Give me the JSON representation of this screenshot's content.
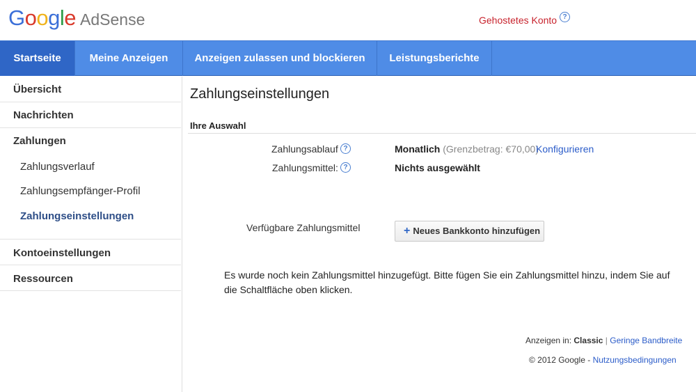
{
  "header": {
    "logo_google": [
      "G",
      "o",
      "o",
      "g",
      "l",
      "e"
    ],
    "logo_product": "AdSense",
    "hosted_account": "Gehostetes Konto",
    "help_glyph": "?"
  },
  "nav": {
    "tabs": [
      {
        "label": "Startseite",
        "active": true
      },
      {
        "label": "Meine Anzeigen"
      },
      {
        "label": "Anzeigen zulassen und blockieren"
      },
      {
        "label": "Leistungsberichte"
      }
    ]
  },
  "sidebar": {
    "items": [
      {
        "label": "Übersicht"
      },
      {
        "label": "Nachrichten"
      },
      {
        "label": "Zahlungen"
      },
      {
        "label": "Zahlungsverlauf"
      },
      {
        "label": "Zahlungsempfänger-Profil"
      },
      {
        "label": "Zahlungseinstellungen",
        "active": true
      },
      {
        "label": "Kontoeinstellungen"
      },
      {
        "label": "Ressourcen"
      }
    ]
  },
  "main": {
    "title": "Zahlungseinstellungen",
    "section": "Ihre Auswahl",
    "schedule_label": "Zahlungsablauf",
    "schedule_value": "Monatlich",
    "schedule_threshold": "(Grenzbetrag: €70,00)",
    "configure_link": "Konfigurieren",
    "method_label": "Zahlungsmittel:",
    "method_value": "Nichts ausgewählt",
    "available_label": "Verfügbare Zahlungsmittel",
    "add_button": "Neues Bankkonto hinzufügen",
    "add_icon": "+",
    "notice": "Es wurde noch kein Zahlungsmittel hinzugefügt. Bitte fügen Sie ein Zahlungsmittel hinzu, indem Sie auf die Schaltfläche oben klicken."
  },
  "footer": {
    "display_prefix": "Anzeigen in:",
    "display_current": "Classic",
    "separator": "|",
    "display_alt": "Geringe Bandbreite",
    "copyright": "© 2012 Google -",
    "terms": "Nutzungsbedingungen"
  },
  "colors": {
    "nav_bg": "#4f8ce6",
    "nav_active": "#2f66c6",
    "link": "#2b5cc9",
    "hosted": "#c8232d"
  }
}
